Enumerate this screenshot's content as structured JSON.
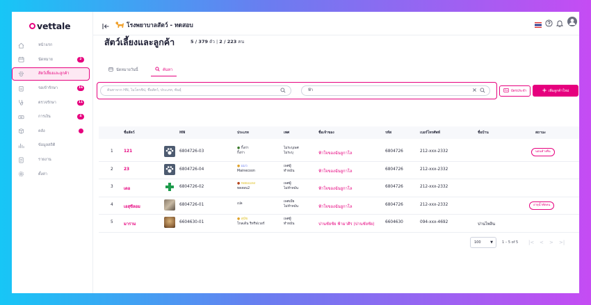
{
  "brand": {
    "name": "vettale",
    "accent": "#e6007e"
  },
  "clinic": {
    "name": "โรงพยาบาลสัตว์ - ทดสอบ"
  },
  "sidebar": {
    "items": [
      {
        "label": "หน้าแรก",
        "icon": "home-icon",
        "badge": ""
      },
      {
        "label": "นัดหมาย",
        "icon": "calendar-icon",
        "badge": "2"
      },
      {
        "label": "สัตว์เลี้ยงและลูกค้า",
        "icon": "paw-icon",
        "badge": "",
        "active": true
      },
      {
        "label": "รอเข้ารักษา",
        "icon": "clipboard-icon",
        "badge": "16"
      },
      {
        "label": "ตรวจรักษา",
        "icon": "stethoscope-icon",
        "badge": "11"
      },
      {
        "label": "การเงิน",
        "icon": "cash-icon",
        "badge": "4"
      },
      {
        "label": "คลัง",
        "icon": "box-icon",
        "badge": "dot"
      },
      {
        "label": "ข้อมูลสถิติ",
        "icon": "stats-icon",
        "badge": ""
      },
      {
        "label": "รายงาน",
        "icon": "report-icon",
        "badge": ""
      },
      {
        "label": "ตั้งค่า",
        "icon": "gear-icon",
        "badge": ""
      }
    ]
  },
  "page": {
    "title": "สัตว์เลี้ยงและลูกค้า",
    "count_pets": "5 / 379",
    "count_pets_unit": "ตัว",
    "count_owners": "2 / 223",
    "count_owners_unit": "คน"
  },
  "tabs": [
    {
      "label": "นัดหมายวันนี้",
      "icon": "calendar-icon"
    },
    {
      "label": "ค้นหา",
      "icon": "search-icon",
      "active": true
    }
  ],
  "search": {
    "placeholder": "ค้นหาจาก HN, ไมโครชิป, ชื่อสัตว์, ประเภท, พันธุ์",
    "owner_value": "ฟ้า"
  },
  "buttons": {
    "scan": "บัตรประจำ",
    "add": "เพิ่มลูกค้าใหม่"
  },
  "table": {
    "headers": [
      "ชื่อสัตว์",
      "HN",
      "ประเภท",
      "เพศ",
      "ชื่อเจ้าของ",
      "รหัส",
      "เบอร์โทรศัพท์",
      "ชื่อบ้าน",
      "สถานะ"
    ],
    "rows": [
      {
        "no": "1",
        "name": "121",
        "hn": "6804726-03",
        "img": "paw",
        "type1": "กิ้งก่า",
        "type2": "กิ้งก่า",
        "type_icon": "lizard",
        "sex1": "ไม่ระบุเพศ",
        "sex2": "ไม่ระบุ",
        "owner": "ฟ้าใจของฉันยูกาโล",
        "code": "6804726",
        "phone": "212-xxx-2332",
        "house": "",
        "status": "นอนค้างคืน"
      },
      {
        "no": "2",
        "name": "23",
        "hn": "6804726-04",
        "img": "paw",
        "type1": "แมว",
        "type2": "Mainecoon",
        "type_icon": "cat",
        "sex1": "เพศผู้",
        "sex2": "ทำหมัน",
        "owner": "ฟ้าใจของฉันยูกาโล",
        "code": "6804726",
        "phone": "212-xxx-2332",
        "house": "",
        "status": ""
      },
      {
        "no": "3",
        "name": "เดอ",
        "hn": "6804726-02",
        "img": "cross",
        "type1": "หอยแมลง",
        "type2": "ทดสอบ2",
        "type_icon": "snail",
        "sex1": "เพศผู้",
        "sex2": "ไม่ทำหมัน",
        "owner": "ฟ้าใจของฉันยูกาโล",
        "code": "6804726",
        "phone": "212-xxx-2332",
        "house": "",
        "status": ""
      },
      {
        "no": "4",
        "name": "เอสุขีลอม",
        "hn": "6804726-01",
        "img": "photo",
        "type1": "",
        "type2": "เปล",
        "type_icon": "",
        "sex1": "เพศเมีย",
        "sex2": "ไม่ทำหมัน",
        "owner": "ฟ้าใจของฉันยูกาโล",
        "code": "6804726",
        "phone": "212-xxx-2332",
        "house": "",
        "status": "อายุน้ำพัดทน"
      },
      {
        "no": "5",
        "name": "มาราม",
        "hn": "6604630-01",
        "img": "dog",
        "type1": "สุนัข",
        "type2": "โกลเด้น รีทรีฟเวอร์",
        "type_icon": "dog",
        "sex1": "เพศผู้",
        "sex2": "ทำหมัน",
        "owner": "ปานชัยชัย ฟ้ามาศิร (ปานชัยชัย)",
        "code": "6604630",
        "phone": "094-xxx-4692",
        "house": "ปานไพลิน",
        "status": ""
      }
    ]
  },
  "pagination": {
    "per_page": "100",
    "range": "1 – 5 of 5"
  }
}
